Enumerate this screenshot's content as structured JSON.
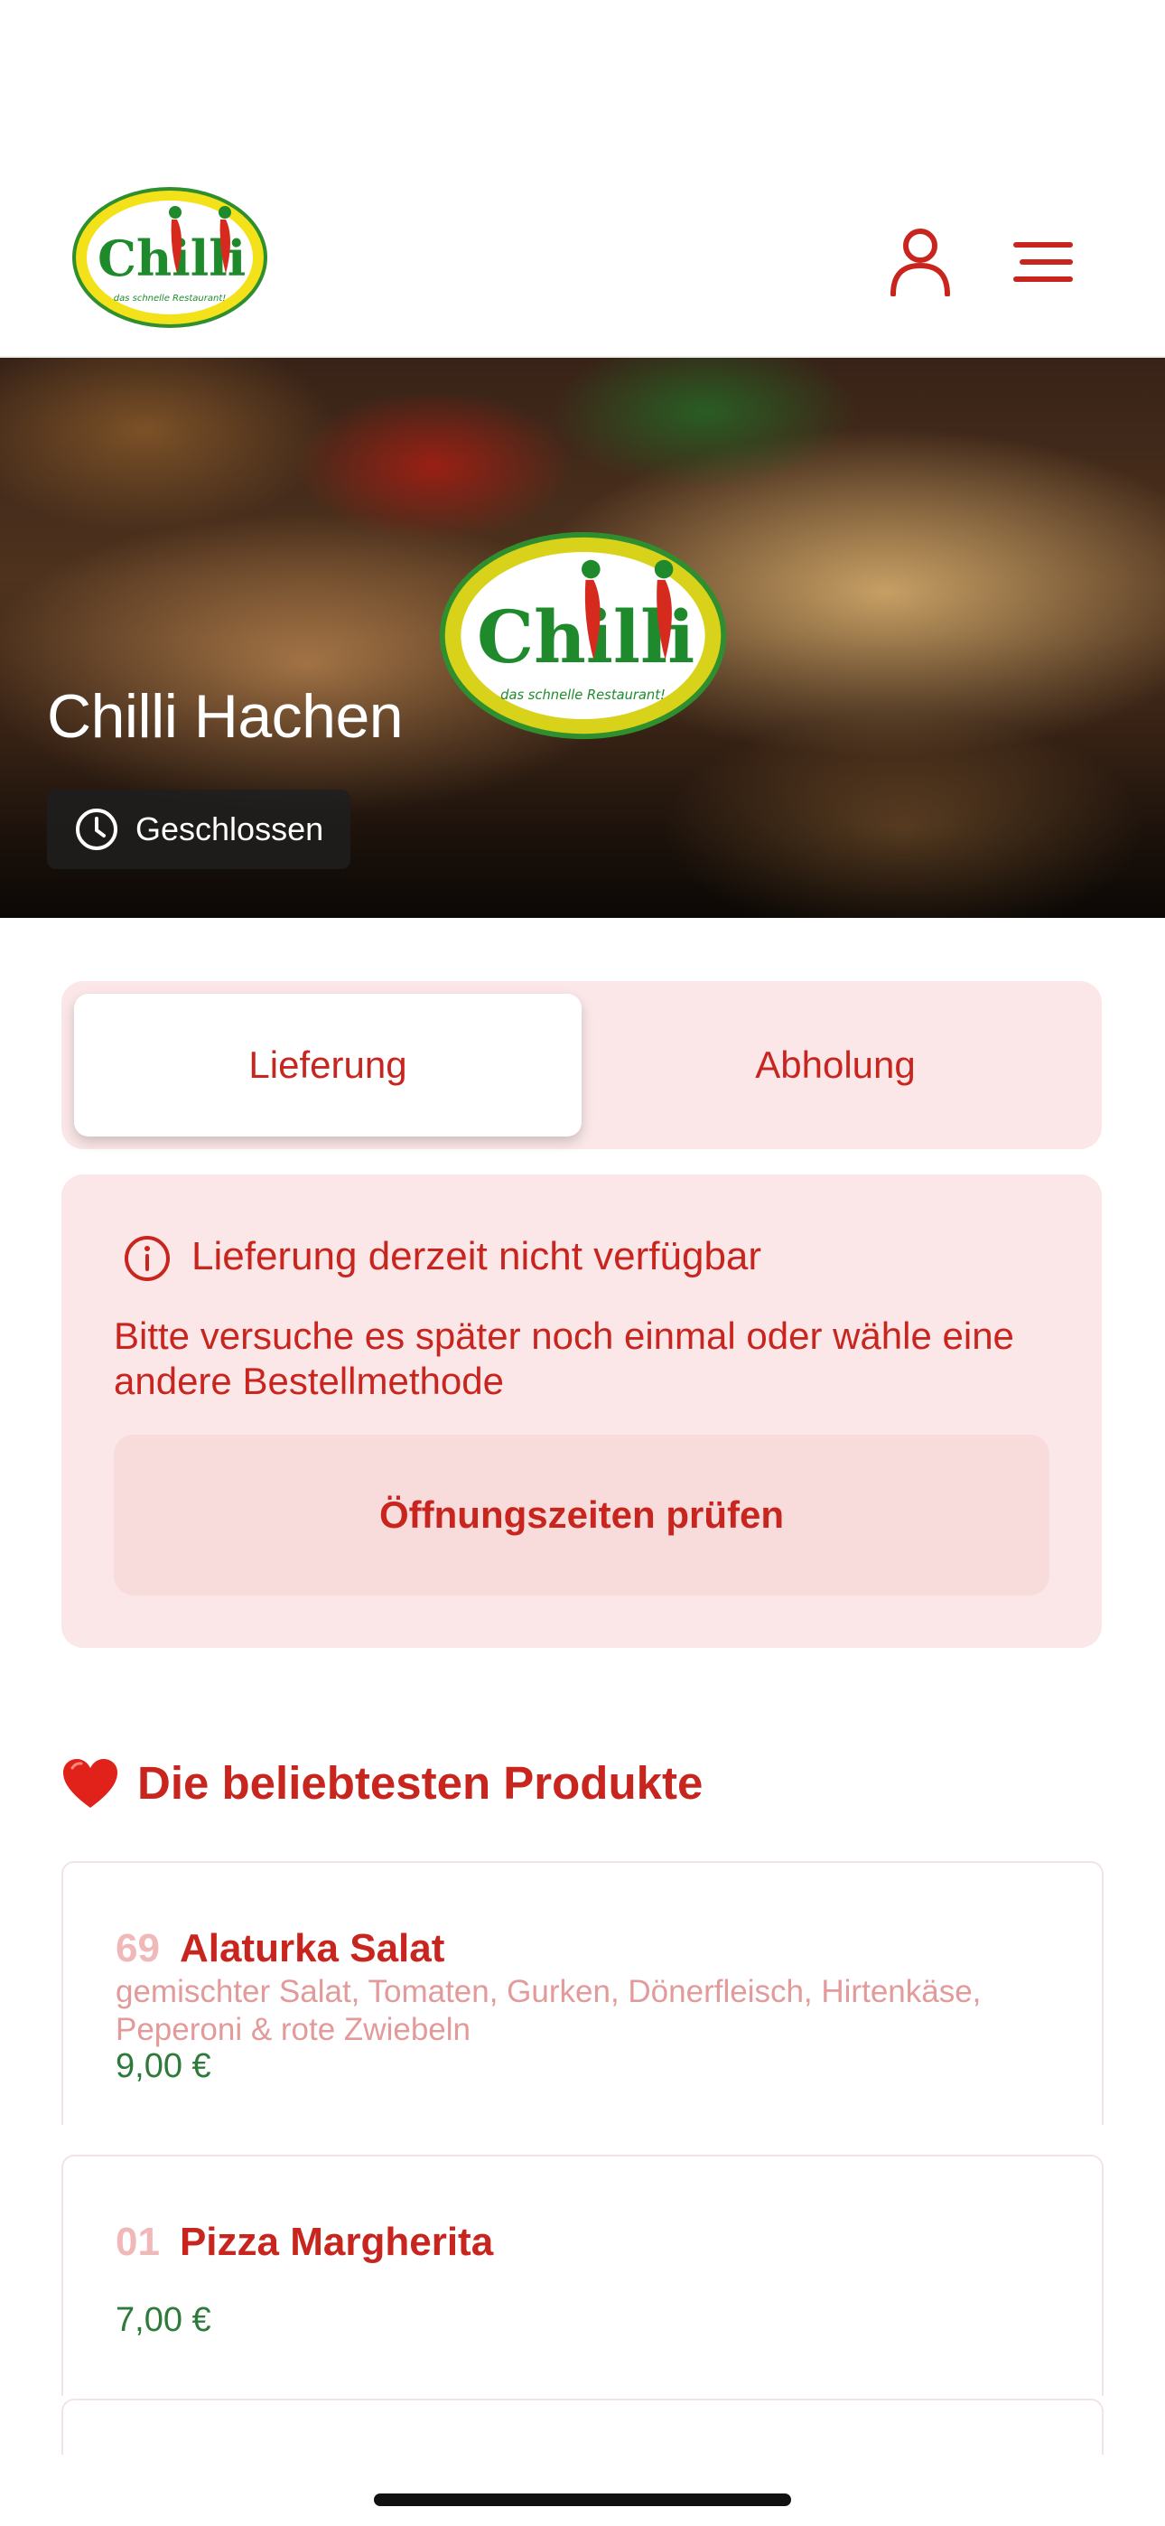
{
  "header": {
    "logo_text": "Chilli",
    "logo_tagline": "das schnelle Restaurant!",
    "account_icon": "user-icon",
    "menu_icon": "hamburger-menu-icon"
  },
  "hero": {
    "restaurant_name": "Chilli Hachen",
    "status": "Geschlossen",
    "status_icon": "clock-icon"
  },
  "order_method": {
    "tabs": [
      {
        "label": "Lieferung",
        "selected": true
      },
      {
        "label": "Abholung",
        "selected": false
      }
    ]
  },
  "notice": {
    "icon": "info-icon",
    "title": "Lieferung derzeit nicht verfügbar",
    "text": "Bitte versuche es später noch einmal oder wähle eine andere Bestellmethode",
    "button_label": "Öffnungszeiten prüfen"
  },
  "popular": {
    "icon": "heart-icon",
    "title": "Die beliebtesten Produkte",
    "products": [
      {
        "number": "69",
        "name": "Alaturka Salat",
        "description": "gemischter Salat, Tomaten, Gurken, Dönerfleisch, Hirtenkäse, Peperoni & rote Zwiebeln",
        "price": "9,00 €"
      },
      {
        "number": "01",
        "name": "Pizza Margherita",
        "description": "",
        "price": "7,00 €"
      }
    ]
  },
  "colors": {
    "brand_red": "#c8251f",
    "tint_bg": "#fbe7e7",
    "price_green": "#2d7a3a"
  }
}
